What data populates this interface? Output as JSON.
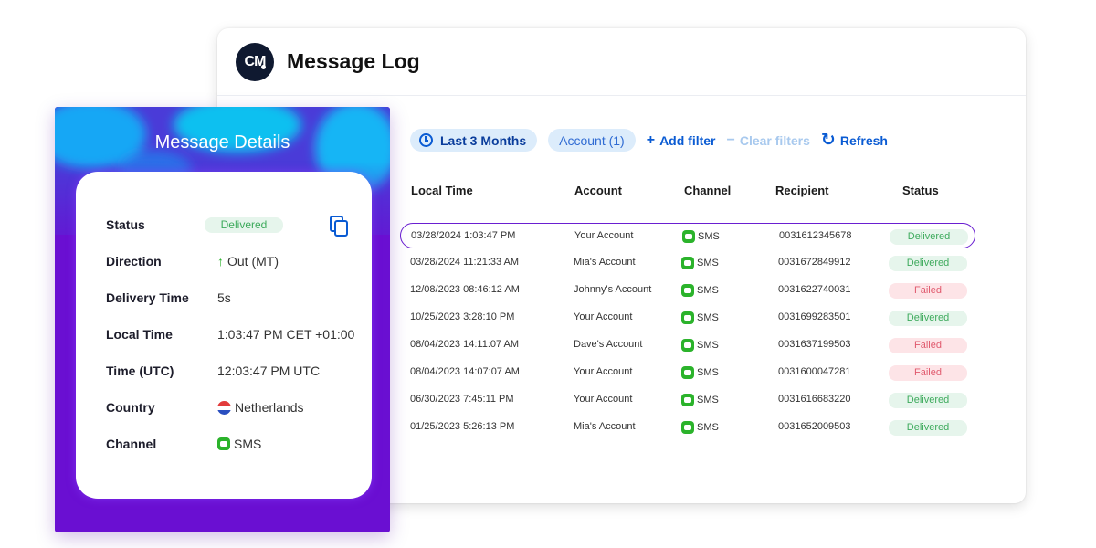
{
  "window": {
    "title": "Message Log",
    "logo_text": "CM"
  },
  "filters": {
    "date_range": "Last 3 Months",
    "account": "Account (1)",
    "add_filter": "Add filter",
    "clear_filters": "Clear filters",
    "refresh": "Refresh"
  },
  "table": {
    "headers": {
      "local_time": "Local Time",
      "account": "Account",
      "channel": "Channel",
      "recipient": "Recipient",
      "status": "Status"
    },
    "rows": [
      {
        "time": "03/28/2024 1:03:47 PM",
        "account": "Your Account",
        "channel": "SMS",
        "recipient": "0031612345678",
        "status": "Delivered"
      },
      {
        "time": "03/28/2024 11:21:33 AM",
        "account": "Mia's Account",
        "channel": "SMS",
        "recipient": "0031672849912",
        "status": "Delivered"
      },
      {
        "time": "12/08/2023 08:46:12 AM",
        "account": "Johnny's Account",
        "channel": "SMS",
        "recipient": "0031622740031",
        "status": "Failed"
      },
      {
        "time": "10/25/2023 3:28:10 PM",
        "account": "Your Account",
        "channel": "SMS",
        "recipient": "0031699283501",
        "status": "Delivered"
      },
      {
        "time": "08/04/2023 14:11:07 AM",
        "account": "Dave's Account",
        "channel": "SMS",
        "recipient": "0031637199503",
        "status": "Failed"
      },
      {
        "time": "08/04/2023 14:07:07 AM",
        "account": "Your Account",
        "channel": "SMS",
        "recipient": "0031600047281",
        "status": "Failed"
      },
      {
        "time": "06/30/2023 7:45:11 PM",
        "account": "Your Account",
        "channel": "SMS",
        "recipient": "0031616683220",
        "status": "Delivered"
      },
      {
        "time": "01/25/2023 5:26:13 PM",
        "account": "Mia's Account",
        "channel": "SMS",
        "recipient": "0031652009503",
        "status": "Delivered"
      }
    ]
  },
  "details": {
    "title": "Message Details",
    "labels": {
      "status": "Status",
      "direction": "Direction",
      "delivery_time": "Delivery Time",
      "local_time": "Local Time",
      "time_utc": "Time (UTC)",
      "country": "Country",
      "channel": "Channel"
    },
    "values": {
      "status": "Delivered",
      "direction": "Out (MT)",
      "delivery_time": "5s",
      "local_time": "1:03:47 PM CET +01:00",
      "time_utc": "12:03:47 PM UTC",
      "country": "Netherlands",
      "channel": "SMS"
    }
  },
  "colors": {
    "accent": "#0a5bd3",
    "brand_purple": "#6a0fd2",
    "delivered": "#3daa5c",
    "failed": "#e05a6e",
    "sms_green": "#2bb32b"
  },
  "icons": [
    "clock-icon",
    "plus-icon",
    "minus-icon",
    "refresh-icon",
    "sms-icon",
    "copy-icon",
    "arrow-up-icon",
    "netherlands-flag-icon"
  ]
}
